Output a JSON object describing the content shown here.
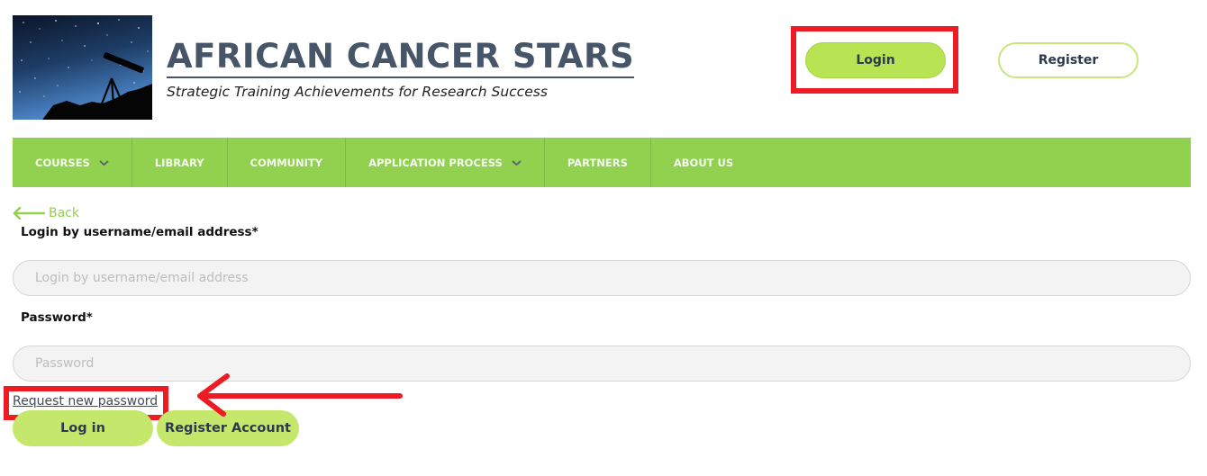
{
  "header": {
    "logo_alt": "telescope-under-stars-logo",
    "title": "AFRICAN CANCER STARS",
    "tagline": "Strategic Training Achievements for Research Success",
    "login_label": "Login",
    "register_label": "Register"
  },
  "nav": {
    "items": [
      {
        "label": "COURSES",
        "has_dropdown": true
      },
      {
        "label": "LIBRARY",
        "has_dropdown": false
      },
      {
        "label": "COMMUNITY",
        "has_dropdown": false
      },
      {
        "label": "APPLICATION PROCESS",
        "has_dropdown": true
      },
      {
        "label": "PARTNERS",
        "has_dropdown": false
      },
      {
        "label": "ABOUT US",
        "has_dropdown": false
      }
    ]
  },
  "form": {
    "back_label": "Back",
    "username_label": "Login by username/email address",
    "username_required": "*",
    "username_value": "",
    "username_placeholder": "Login by username/email address",
    "password_label": "Password",
    "password_required": "*",
    "password_value": "",
    "password_placeholder": "Password",
    "request_password_label": "Request new password",
    "login_button": "Log in",
    "register_button": "Register Account"
  },
  "colors": {
    "brand_text": "#465568",
    "nav_green": "#92d050",
    "button_green": "#c5e86c",
    "annotation_red": "#ed1c24"
  }
}
